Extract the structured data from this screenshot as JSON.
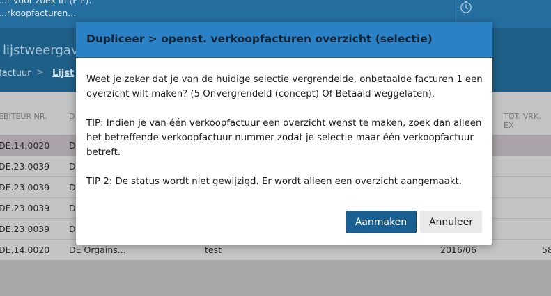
{
  "topbar": {
    "search_hint": "...r voor zoek in (F F).",
    "search_value": "...rkoopfacturen...",
    "clock_icon": "clock-icon"
  },
  "subheader": {
    "view_title": "lijstweergave",
    "breadcrumb": {
      "item1": "factuur",
      "separator": ">",
      "item2": "Lijst"
    }
  },
  "table": {
    "headers": {
      "debtor_nr": "EBITEUR NR.",
      "d": "D",
      "tot_vrk": "TOT. VRK. EX"
    },
    "rows": [
      {
        "debtor": "DE.14.0020",
        "name": "D",
        "desc": "",
        "period": "",
        "amount": "",
        "selected": true
      },
      {
        "debtor": "DE.23.0039",
        "name": "D",
        "desc": "",
        "period": "",
        "amount": ""
      },
      {
        "debtor": "DE.23.0039",
        "name": "D",
        "desc": "",
        "period": "",
        "amount": ""
      },
      {
        "debtor": "DE.23.0039",
        "name": "D",
        "desc": "",
        "period": "",
        "amount": ""
      },
      {
        "debtor": "DE.23.0039",
        "name": "D",
        "desc": "",
        "period": "",
        "amount": ""
      },
      {
        "debtor": "DE.14.0020",
        "name": "DE Orgains...",
        "desc": "test",
        "period": "2016/06",
        "amount": "58"
      }
    ]
  },
  "modal": {
    "title": "Dupliceer > openst. verkoopfacturen overzicht (selectie)",
    "paragraph1": "Weet je zeker dat je van de huidige selectie vergrendelde, onbetaalde facturen 1 een overzicht wilt maken? (5 Onvergrendeld (concept) Of Betaald weggelaten).",
    "paragraph2": "TIP: Indien je van één verkoopfactuur een overzicht wenst te maken, zoek dan alleen het betreffende verkoopfactuur nummer zodat je selectie maar één verkoopfactuur betreft.",
    "paragraph3": "TIP 2: De status wordt niet gewijzigd. Er wordt alleen een overzicht aangemaakt.",
    "create_label": "Aanmaken",
    "cancel_label": "Annuleer"
  },
  "colors": {
    "modal_header": "#2b81c6",
    "primary_button": "#195f92",
    "secondary_button": "#e9e9ea"
  }
}
